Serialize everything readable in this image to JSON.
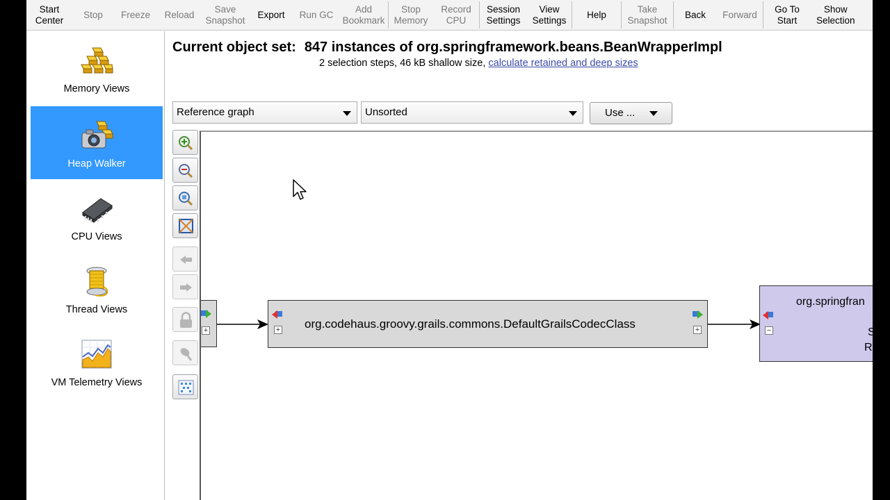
{
  "toolbar": {
    "start_center": "Start\nCenter",
    "stop": "Stop",
    "freeze": "Freeze",
    "reload": "Reload",
    "save_snapshot": "Save\nSnapshot",
    "export": "Export",
    "run_gc": "Run GC",
    "add_bookmark": "Add\nBookmark",
    "stop_memory": "Stop\nMemory",
    "record_cpu": "Record\nCPU",
    "session_settings": "Session\nSettings",
    "view_settings": "View\nSettings",
    "help": "Help",
    "take_snapshot": "Take\nSnapshot",
    "back": "Back",
    "forward": "Forward",
    "go_to_start": "Go To\nStart",
    "show_selection": "Show\nSelection"
  },
  "sidebar": {
    "items": [
      {
        "label": "Memory Views",
        "icon": "gold-bars-icon"
      },
      {
        "label": "Heap Walker",
        "icon": "camera-gold-icon"
      },
      {
        "label": "CPU Views",
        "icon": "chip-icon"
      },
      {
        "label": "Thread Views",
        "icon": "thread-spool-icon"
      },
      {
        "label": "VM Telemetry Views",
        "icon": "telemetry-chart-icon"
      }
    ],
    "active": "Heap Walker"
  },
  "header": {
    "title_prefix": "Current object set:",
    "title": "847 instances of org.springframework.beans.BeanWrapperImpl",
    "subtitle": "2 selection steps, 46 kB shallow size,",
    "link": "calculate retained and deep sizes"
  },
  "controls": {
    "view_select": "Reference graph",
    "sort_select": "Unsorted",
    "use_button": "Use ..."
  },
  "graph": {
    "tools": [
      "zoom-in-icon",
      "zoom-out-icon",
      "zoom-fit-icon",
      "fit-content-icon",
      "previous-icon",
      "next-icon",
      "lock-icon",
      "pin-icon",
      "layout-icon"
    ],
    "main_node": "org.codehaus.groovy.grails.commons.DefaultGrailsCodecClass",
    "right_node": "org.springfran",
    "right_node_line2": "S",
    "right_node_line3": "R"
  },
  "colors": {
    "sidebar_active": "#3399ff",
    "node_grey": "#d9d9d9",
    "node_purple": "#cfc9ec"
  }
}
